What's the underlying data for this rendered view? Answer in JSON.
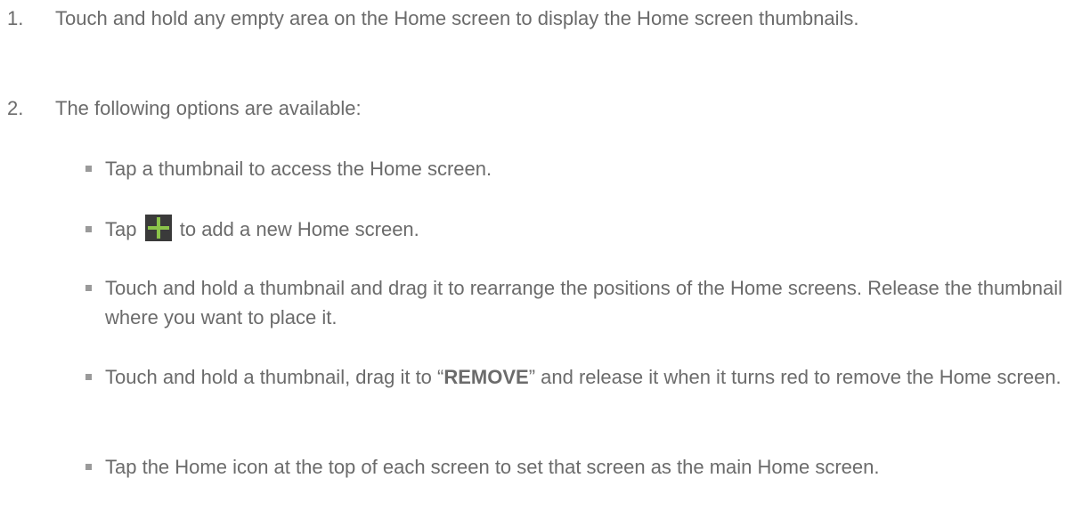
{
  "steps": [
    {
      "number": "1.",
      "text": "Touch and hold any empty area on the Home screen to display the Home screen thumbnails."
    },
    {
      "number": "2.",
      "text": "The following options are available:"
    }
  ],
  "options": {
    "tap_thumbnail": "Tap a thumbnail to access the Home screen.",
    "add_prefix": "Tap",
    "add_suffix": "to add a new Home screen.",
    "add_icon": "plus-icon",
    "rearrange": "Touch and hold a thumbnail and drag it to rearrange the positions of the Home screens. Release the thumbnail where you want to place it.",
    "remove_prefix": "Touch and hold a thumbnail, drag it to “",
    "remove_keyword": "REMOVE",
    "remove_suffix": "” and release it when it turns red to remove the Home screen.",
    "set_main": "Tap the Home icon at the top of each screen to set that screen as the main Home screen."
  },
  "colors": {
    "text": "#6b6b6b",
    "icon_background": "#3a3a3a",
    "icon_plus": "#8bc34a"
  }
}
